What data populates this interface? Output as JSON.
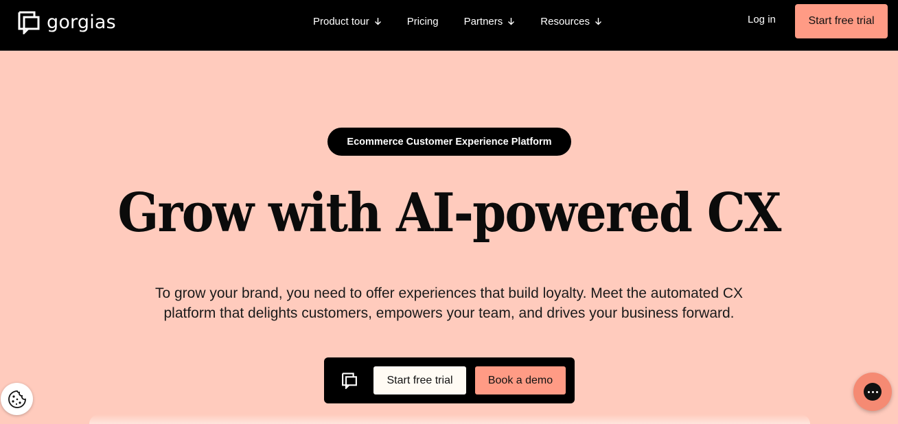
{
  "header": {
    "logo_text": "gorgias",
    "nav": [
      {
        "label": "Product tour",
        "has_dropdown": true
      },
      {
        "label": "Pricing",
        "has_dropdown": false
      },
      {
        "label": "Partners",
        "has_dropdown": true
      },
      {
        "label": "Resources",
        "has_dropdown": true
      }
    ],
    "login_label": "Log in",
    "cta_label": "Start free trial"
  },
  "hero": {
    "badge": "Ecommerce Customer Experience Platform",
    "headline": "Grow with AI-powered CX",
    "subtext": "To grow your brand, you need to offer experiences that build loyalty. Meet the automated CX platform that delights customers, empowers your team, and drives your business forward."
  },
  "cta_bar": {
    "trial_label": "Start free trial",
    "demo_label": "Book a demo"
  },
  "icons": {
    "logo": "gorgias-logo-icon",
    "nav_dropdown": "arrow-down-icon",
    "cookie": "cookie-icon",
    "chat": "chat-bubble-icon"
  },
  "colors": {
    "background": "#ffcbbd",
    "header": "#000000",
    "accent": "#ff9b85",
    "chat": "#f58a73"
  }
}
